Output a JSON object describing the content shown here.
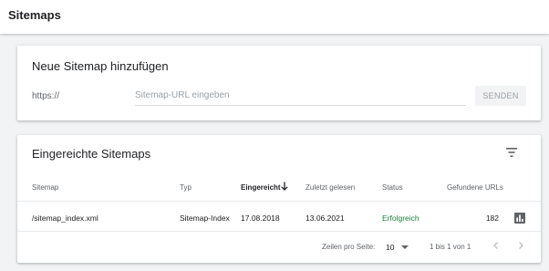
{
  "header": {
    "title": "Sitemaps"
  },
  "add_sitemap": {
    "title": "Neue Sitemap hinzufügen",
    "prefix": "https://",
    "input_value": "",
    "input_placeholder": "Sitemap-URL eingeben",
    "submit_label": "SENDEN"
  },
  "submitted": {
    "title": "Eingereichte Sitemaps",
    "columns": {
      "sitemap": "Sitemap",
      "type": "Typ",
      "submitted": "Eingereicht",
      "last_read": "Zuletzt gelesen",
      "status": "Status",
      "found_urls": "Gefundene URLs"
    },
    "sort_column": "submitted",
    "sort_direction": "descending",
    "rows": [
      {
        "sitemap": "/sitemap_index.xml",
        "type": "Sitemap-Index",
        "submitted": "17.08.2018",
        "last_read": "13.06.2021",
        "status": "Erfolgreich",
        "found_urls": "182"
      }
    ],
    "pagination": {
      "rows_per_page_label": "Zeilen pro Seite:",
      "rows_per_page_value": "10",
      "range_text": "1 bis 1 von 1"
    }
  },
  "icons": {
    "filter": "filter-icon",
    "sort": "arrow-down-icon",
    "report": "bar-chart-icon",
    "prev": "chevron-left-icon",
    "next": "chevron-right-icon"
  },
  "colors": {
    "status_success": "#188038",
    "page_background": "#f1f3f4",
    "muted_text": "#5f6368"
  }
}
